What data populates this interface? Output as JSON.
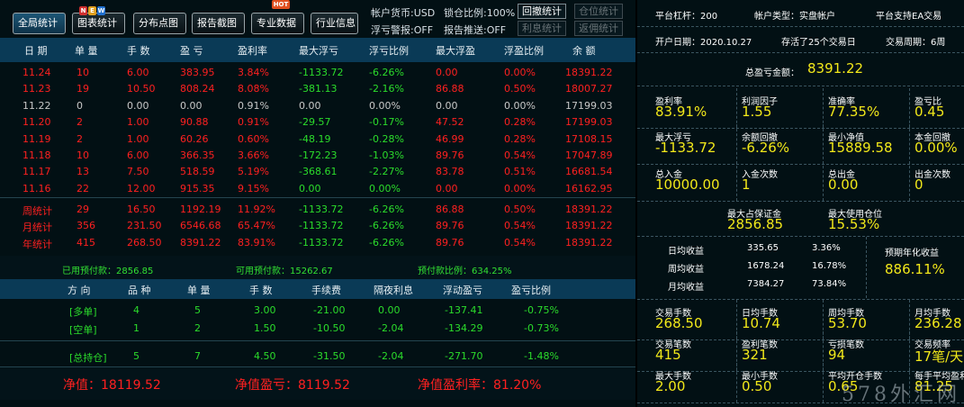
{
  "toolbar": {
    "buttons": [
      "全局统计",
      "图表统计",
      "分布点图",
      "报告截图",
      "专业数据",
      "行业信息"
    ],
    "new_badge": [
      "N",
      "E",
      "W"
    ],
    "hot_badge": "HOT",
    "account_currency": "帐户货币:USD",
    "lock_ratio": "锁仓比例:100%",
    "float_warn": "浮亏警报:OFF",
    "report_push": "报告推送:OFF",
    "btn_drawdown": "回撤统计",
    "btn_position": "仓位统计",
    "btn_interest": "利息统计",
    "btn_commission": "返佣统计"
  },
  "table": {
    "headers": [
      "日 期",
      "单 量",
      "手 数",
      "盈 亏",
      "盈利率",
      "最大浮亏",
      "浮亏比例",
      "最大浮盈",
      "浮盈比例",
      "余 额"
    ],
    "rows": [
      {
        "c": "red",
        "v": [
          "11.24",
          "10",
          "6.00",
          "383.95",
          "3.84%",
          "-1133.72",
          "-6.26%",
          "0.00",
          "0.00%",
          "18391.22"
        ]
      },
      {
        "c": "red",
        "v": [
          "11.23",
          "19",
          "10.50",
          "808.24",
          "8.08%",
          "-381.13",
          "-2.16%",
          "86.88",
          "0.50%",
          "18007.27"
        ]
      },
      {
        "c": "gray",
        "v": [
          "11.22",
          "0",
          "0.00",
          "0.00",
          "0.91%",
          "0.00",
          "0.00%",
          "0.00",
          "0.00%",
          "17199.03"
        ]
      },
      {
        "c": "red",
        "v": [
          "11.20",
          "2",
          "1.00",
          "90.88",
          "0.91%",
          "-29.57",
          "-0.17%",
          "47.52",
          "0.28%",
          "17199.03"
        ]
      },
      {
        "c": "red",
        "v": [
          "11.19",
          "2",
          "1.00",
          "60.26",
          "0.60%",
          "-48.19",
          "-0.28%",
          "46.99",
          "0.28%",
          "17108.15"
        ]
      },
      {
        "c": "red",
        "v": [
          "11.18",
          "10",
          "6.00",
          "366.35",
          "3.66%",
          "-172.23",
          "-1.03%",
          "89.76",
          "0.54%",
          "17047.89"
        ]
      },
      {
        "c": "red",
        "v": [
          "11.17",
          "13",
          "7.50",
          "518.59",
          "5.19%",
          "-368.61",
          "-2.27%",
          "83.78",
          "0.51%",
          "16681.54"
        ]
      },
      {
        "c": "red",
        "v": [
          "11.16",
          "22",
          "12.00",
          "915.35",
          "9.15%",
          "0.00",
          "0.00%",
          "0.00",
          "0.00%",
          "16162.95"
        ]
      }
    ],
    "totals": [
      [
        "周统计",
        "29",
        "16.50",
        "1192.19",
        "11.92%",
        "-1133.72",
        "-6.26%",
        "86.88",
        "0.50%",
        "18391.22"
      ],
      [
        "月统计",
        "356",
        "231.50",
        "6546.68",
        "65.47%",
        "-1133.72",
        "-6.26%",
        "89.76",
        "0.54%",
        "18391.22"
      ],
      [
        "年统计",
        "415",
        "268.50",
        "8391.22",
        "83.91%",
        "-1133.72",
        "-6.26%",
        "89.76",
        "0.54%",
        "18391.22"
      ]
    ]
  },
  "summary": {
    "used_margin": "已用预付款：2856.85",
    "free_margin": "可用预付款：15262.67",
    "margin_ratio": "预付款比例：634.25%"
  },
  "positions": {
    "headers": [
      "方 向",
      "品 种",
      "单 量",
      "手 数",
      "手续费",
      "隔夜利息",
      "浮动盈亏",
      "盈亏比例"
    ],
    "rows": [
      [
        "[多单]",
        "4",
        "5",
        "3.00",
        "-21.00",
        "0.00",
        "-137.41",
        "-0.75%"
      ],
      [
        "[空单]",
        "1",
        "2",
        "1.50",
        "-10.50",
        "-2.04",
        "-134.29",
        "-0.73%"
      ],
      [
        "[总持仓]",
        "5",
        "7",
        "4.50",
        "-31.50",
        "-2.04",
        "-271.70",
        "-1.48%"
      ]
    ]
  },
  "footer": {
    "net_value": "净值：18119.52",
    "net_pl": "净值盈亏：8119.52",
    "net_rate": "净值盈利率：81.20%"
  },
  "right": {
    "leverage": "平台杠杆：200",
    "account_type": "帐户类型：实盘帐户",
    "ea_support": "平台支持EA交易",
    "open_date": "开户日期：2020.10.27",
    "days": "存活了25个交易日",
    "cycle": "交易周期：6周",
    "total_pl_label": "总盈亏金额：",
    "total_pl_value": "8391.22",
    "grid1": [
      [
        {
          "l": "盈利率",
          "v": "83.91%"
        },
        {
          "l": "利润因子",
          "v": "1.55"
        },
        {
          "l": "准确率",
          "v": "77.35%"
        },
        {
          "l": "盈亏比",
          "v": "0.45"
        }
      ],
      [
        {
          "l": "最大浮亏",
          "v": "-1133.72"
        },
        {
          "l": "余额回撤",
          "v": "-6.26%"
        },
        {
          "l": "最小净值",
          "v": "15889.58"
        },
        {
          "l": "本金回撤",
          "v": "0.00%"
        }
      ],
      [
        {
          "l": "总入金",
          "v": "10000.00"
        },
        {
          "l": "入金次数",
          "v": "1"
        },
        {
          "l": "总出金",
          "v": "0.00"
        },
        {
          "l": "出金次数",
          "v": "0"
        }
      ]
    ],
    "max_margin_label": "最大占保证金",
    "max_margin_value": "2856.85",
    "max_pos_label": "最大使用仓位",
    "max_pos_value": "15.53%",
    "avg": [
      {
        "l": "日均收益",
        "a": "335.65",
        "p": "3.36%"
      },
      {
        "l": "周均收益",
        "a": "1678.24",
        "p": "16.78%"
      },
      {
        "l": "月均收益",
        "a": "7384.27",
        "p": "73.84%"
      }
    ],
    "annual_label": "预期年化收益",
    "annual_value": "886.11%",
    "grid2": [
      [
        {
          "l": "交易手数",
          "v": "268.50"
        },
        {
          "l": "日均手数",
          "v": "10.74"
        },
        {
          "l": "周均手数",
          "v": "53.70"
        },
        {
          "l": "月均手数",
          "v": "236.28"
        }
      ],
      [
        {
          "l": "交易笔数",
          "v": "415"
        },
        {
          "l": "盈利笔数",
          "v": "321"
        },
        {
          "l": "亏损笔数",
          "v": "94"
        },
        {
          "l": "交易频率",
          "v": "17笔/天"
        }
      ],
      [
        {
          "l": "最大手数",
          "v": "2.00"
        },
        {
          "l": "最小手数",
          "v": "0.50"
        },
        {
          "l": "平均开仓手数",
          "v": "0.65"
        },
        {
          "l": "每手平均盈利",
          "v": "81.25"
        }
      ]
    ],
    "watermark": "578外汇网"
  }
}
